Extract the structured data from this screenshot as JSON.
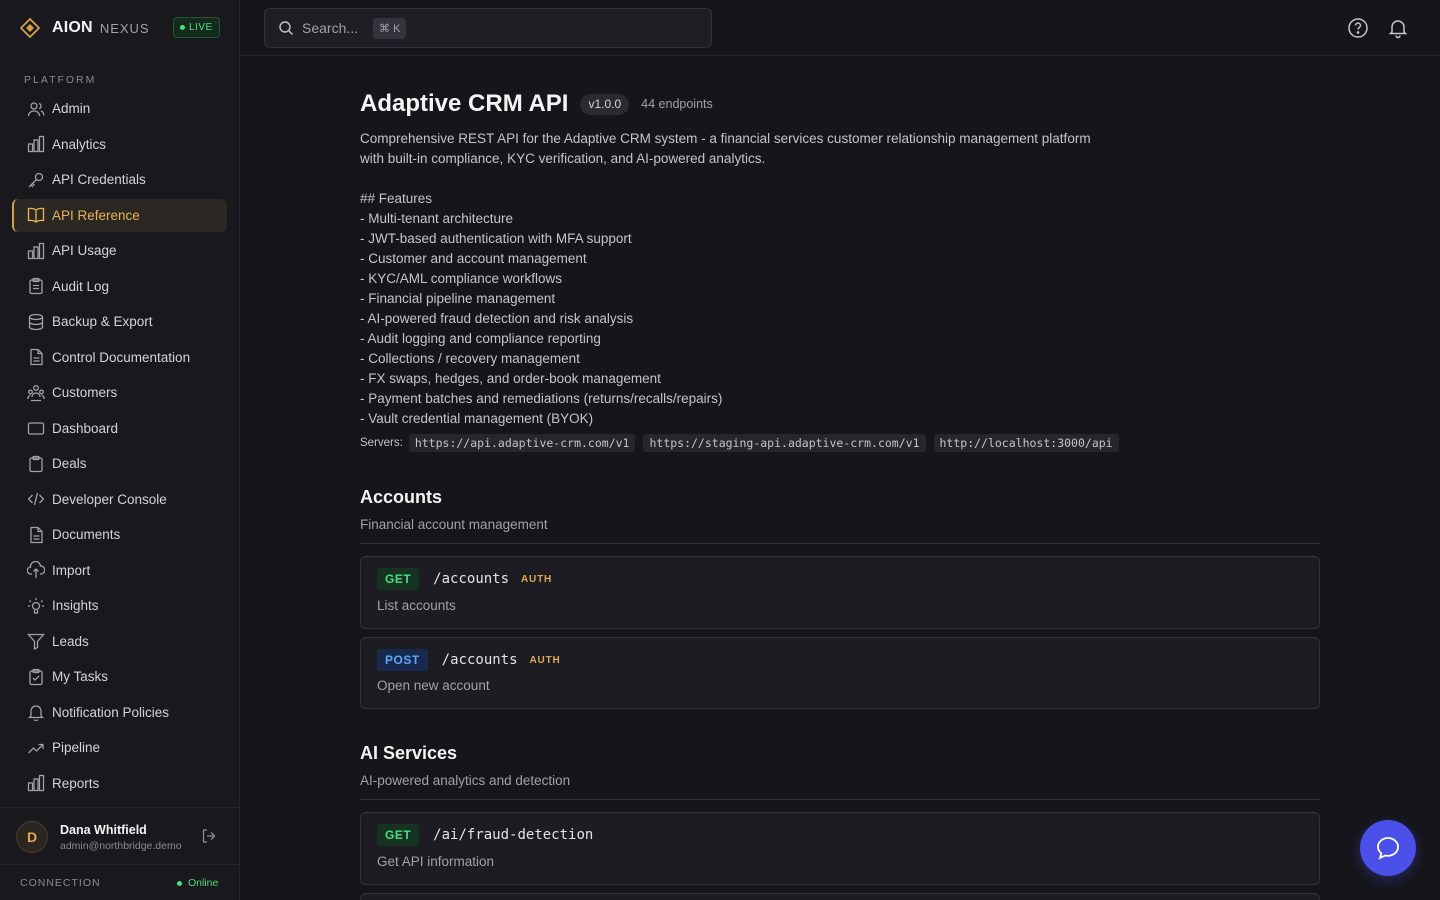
{
  "brand": {
    "name": "AION",
    "sub": "NEXUS",
    "live_label": "LIVE"
  },
  "sidebar": {
    "section_label": "PLATFORM",
    "items": [
      {
        "label": "Admin",
        "icon": "users-icon"
      },
      {
        "label": "Analytics",
        "icon": "bar-chart-icon"
      },
      {
        "label": "API Credentials",
        "icon": "key-icon"
      },
      {
        "label": "API Reference",
        "icon": "book-icon",
        "active": true
      },
      {
        "label": "API Usage",
        "icon": "bar-chart-icon"
      },
      {
        "label": "Audit Log",
        "icon": "clipboard-icon"
      },
      {
        "label": "Backup & Export",
        "icon": "database-icon"
      },
      {
        "label": "Control Documentation",
        "icon": "file-icon"
      },
      {
        "label": "Customers",
        "icon": "people-icon"
      },
      {
        "label": "Dashboard",
        "icon": "monitor-icon"
      },
      {
        "label": "Deals",
        "icon": "clipboard-icon"
      },
      {
        "label": "Developer Console",
        "icon": "code-icon"
      },
      {
        "label": "Documents",
        "icon": "file-icon"
      },
      {
        "label": "Import",
        "icon": "cloud-upload-icon"
      },
      {
        "label": "Insights",
        "icon": "lightbulb-icon"
      },
      {
        "label": "Leads",
        "icon": "funnel-icon"
      },
      {
        "label": "My Tasks",
        "icon": "clipboard-check-icon"
      },
      {
        "label": "Notification Policies",
        "icon": "bell-icon"
      },
      {
        "label": "Pipeline",
        "icon": "trending-icon"
      },
      {
        "label": "Reports",
        "icon": "bar-chart-icon"
      }
    ]
  },
  "user": {
    "initial": "D",
    "name": "Dana Whitfield",
    "email": "admin@northbridge.demo"
  },
  "connection": {
    "label": "CONNECTION",
    "status": "Online"
  },
  "search": {
    "placeholder": "Search...",
    "shortcut": "⌘ K"
  },
  "api": {
    "title": "Adaptive CRM API",
    "version": "v1.0.0",
    "endpoint_count": "44 endpoints",
    "description_lines": [
      "Comprehensive REST API for the Adaptive CRM system - a financial services customer relationship management platform",
      "with built-in compliance, KYC verification, and AI-powered analytics.",
      "",
      "## Features",
      "- Multi-tenant architecture",
      "- JWT-based authentication with MFA support",
      "- Customer and account management",
      "- KYC/AML compliance workflows",
      "- Financial pipeline management",
      "- AI-powered fraud detection and risk analysis",
      "- Audit logging and compliance reporting",
      "- Collections / recovery management",
      "- FX swaps, hedges, and order-book management",
      "- Payment batches and remediations (returns/recalls/repairs)",
      "- Vault credential management (BYOK)"
    ],
    "servers_label": "Servers:",
    "servers": [
      "https://api.adaptive-crm.com/v1",
      "https://staging-api.adaptive-crm.com/v1",
      "http://localhost:3000/api"
    ]
  },
  "sections": [
    {
      "title": "Accounts",
      "description": "Financial account management",
      "endpoints": [
        {
          "method": "GET",
          "path": "/accounts",
          "auth": "AUTH",
          "summary": "List accounts"
        },
        {
          "method": "POST",
          "path": "/accounts",
          "auth": "AUTH",
          "summary": "Open new account"
        }
      ]
    },
    {
      "title": "AI Services",
      "description": "AI-powered analytics and detection",
      "endpoints": [
        {
          "method": "GET",
          "path": "/ai/fraud-detection",
          "auth": "",
          "summary": "Get API information"
        }
      ]
    }
  ],
  "colors": {
    "accent": "#e0a94f",
    "live": "#4ade80",
    "get": "#4ade80",
    "post": "#60a5fa",
    "fab": "#4a50e8"
  }
}
